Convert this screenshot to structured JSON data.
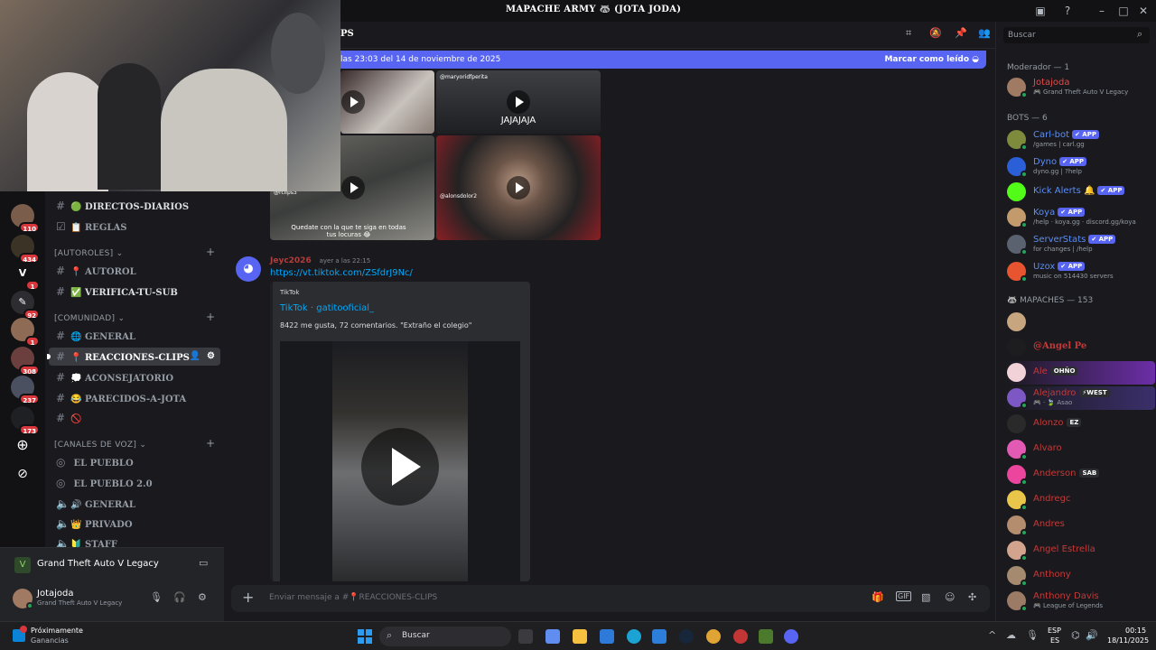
{
  "window": {
    "title": "MAPACHE ARMY 🦝 (JOTA JODA)"
  },
  "header": {
    "channel_fragment": "PS",
    "search_placeholder": "Buscar"
  },
  "new_messages": {
    "text": "las 23:03 del 14 de noviembre de 2025",
    "action": "Marcar como leído"
  },
  "rail": {
    "badges": [
      "110",
      "434",
      "1",
      "92",
      "1",
      "308",
      "237",
      "173"
    ]
  },
  "channels": {
    "top": [
      {
        "name": "DIRECTOS-DIARIOS",
        "emoji": "🟢"
      },
      {
        "name": "REGLAS",
        "emoji": "📋"
      }
    ],
    "categories": [
      {
        "title": "[AUTOROLES]",
        "items": [
          {
            "name": "AUTOROL",
            "emoji": "📍"
          },
          {
            "name": "VERIFICA-TU-SUB",
            "emoji": "✅"
          }
        ]
      },
      {
        "title": "[COMUNIDAD]",
        "items": [
          {
            "name": "GENERAL",
            "emoji": "🌐"
          },
          {
            "name": "REACCIONES-CLIPS",
            "emoji": "📍"
          },
          {
            "name": "ACONSEJATORIO",
            "emoji": "💭"
          },
          {
            "name": "PARECIDOS-A-JOTA",
            "emoji": "😂"
          },
          {
            "name": "",
            "emoji": "🚫"
          }
        ]
      },
      {
        "title": "[CANALES DE VOZ]",
        "items": [
          {
            "name": "EL PUEBLO",
            "emoji": ""
          },
          {
            "name": "EL PUEBLO 2.0",
            "emoji": ""
          },
          {
            "name": "GENERAL",
            "emoji": "🔊"
          },
          {
            "name": "PRIVADO",
            "emoji": "👑"
          },
          {
            "name": "STAFF",
            "emoji": "🔰"
          }
        ]
      }
    ]
  },
  "activity": {
    "game": "Grand Theft Auto V Legacy"
  },
  "user": {
    "name": "Jotajoda",
    "status": "Grand Theft Auto V Legacy"
  },
  "messages": {
    "thumbs": [
      "JAJAJAJA",
      "Quedate con la que te siga en todas tus locuras 😂"
    ],
    "tiktok_handles": [
      "@maryoridfperita",
      "@rclips3",
      "@alonsdolor2"
    ],
    "msg": {
      "author": "Jeyc2026",
      "time": "ayer a las 22:15",
      "link": "https://vt.tiktok.com/ZSfdrJ9Nc/",
      "embed_provider": "TikTok",
      "embed_title": "TikTok · gatitooficial_",
      "embed_desc": "8422 me gusta, 72 comentarios. \"Extraño el colegio\""
    }
  },
  "composer": {
    "placeholder": "Enviar mensaje a #📍REACCIONES-CLIPS"
  },
  "members": {
    "moderator_header": "Moderador — 1",
    "moderator": {
      "name": "Jotajoda",
      "sub": "🎮 Grand Theft Auto V Legacy"
    },
    "bots_header": "BOTS — 6",
    "bots": [
      {
        "name": "Carl-bot",
        "sub": "/games | carl.gg",
        "color": "#5865f2"
      },
      {
        "name": "Dyno",
        "sub": "dyno.gg | ?help",
        "color": "#3b6ee0"
      },
      {
        "name": "Kick Alerts",
        "sub": "",
        "color": "#53fc18"
      },
      {
        "name": "Koya",
        "sub": "/help · koya.gg · discord.gg/koya",
        "color": "#c29a6b"
      },
      {
        "name": "ServerStats",
        "sub": "for changes | /help",
        "color": "#5a6270"
      },
      {
        "name": "Uzox",
        "sub": "music on 514430 servers",
        "color": "#e8542f"
      }
    ],
    "app_label": "✔ APP",
    "mapaches_header": "🦝 MAPACHES — 153",
    "list": [
      {
        "name": "",
        "sub": "",
        "tag": ""
      },
      {
        "name": "@Angel Pe",
        "sub": "",
        "tag": ""
      },
      {
        "name": "Ale",
        "sub": "",
        "tag": "OHÑO"
      },
      {
        "name": "Alejandro",
        "sub": "🎮 · 🍃 Asao",
        "tag": "⚡WEST"
      },
      {
        "name": "Alonzo",
        "sub": "",
        "tag": "EZ"
      },
      {
        "name": "Alvaro",
        "sub": "",
        "tag": ""
      },
      {
        "name": "Anderson",
        "sub": "",
        "tag": "SAB"
      },
      {
        "name": "Andregc",
        "sub": "",
        "tag": ""
      },
      {
        "name": "Andres",
        "sub": "",
        "tag": ""
      },
      {
        "name": "Angel Estrella",
        "sub": "",
        "tag": ""
      },
      {
        "name": "Anthony",
        "sub": "",
        "tag": ""
      },
      {
        "name": "Anthony Davis",
        "sub": "🎮 League of Legends",
        "tag": ""
      }
    ]
  },
  "taskbar": {
    "notice_title": "Próximamente",
    "notice_sub": "Ganancias",
    "search": "Buscar",
    "lang1": "ESP",
    "lang2": "ES",
    "time": "00:15",
    "date": "18/11/2025"
  }
}
